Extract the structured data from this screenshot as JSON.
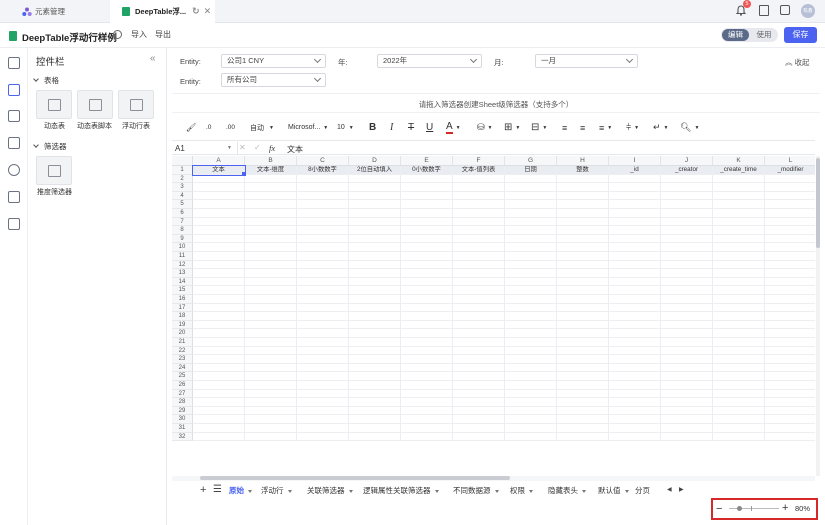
{
  "browser_tabs": [
    {
      "label": "元素管理",
      "active": false
    },
    {
      "label": "DeepTable浮...",
      "active": true
    }
  ],
  "notification_count": "5",
  "avatar_text": "陈鑫",
  "app": {
    "title": "DeepTable浮动行样例",
    "import_label": "导入",
    "export_label": "导出",
    "mode_edit": "编辑",
    "mode_use": "使用",
    "save_label": "保存"
  },
  "panel": {
    "title": "控件栏",
    "collapse": "«",
    "section_table": "表格",
    "section_filter": "筛选器",
    "components": [
      {
        "label": "动态表"
      },
      {
        "label": "动态表脚本"
      },
      {
        "label": "浮动行表"
      }
    ],
    "filters": [
      {
        "label": "推度筛选器"
      }
    ]
  },
  "filters": {
    "entity_label": "Entity:",
    "entity_value": "公司1 CNY",
    "year_label": "年:",
    "year_value": "2022年",
    "month_label": "月:",
    "month_value": "一月",
    "collapse_label": "收起",
    "entity2_label": "Entity:",
    "entity2_value": "所有公司",
    "drop_hint": "请拖入筛选器创建Sheet级筛选器（支持多个）"
  },
  "toolbar": {
    "auto_label": "自动",
    "font_label": "Microsof...",
    "size_label": "10"
  },
  "formula": {
    "cell_ref": "A1",
    "fx": "fx",
    "value": "文本"
  },
  "grid": {
    "columns": [
      "A",
      "B",
      "C",
      "D",
      "E",
      "F",
      "G",
      "H",
      "I",
      "J",
      "K",
      "L"
    ],
    "header_row": [
      "文本",
      "文本-维度",
      "8小数数字",
      "2位自动填入",
      "0小数数字",
      "文本-值列表",
      "日期",
      "整数",
      "_id",
      "_creator",
      "_create_time",
      "_modifier"
    ],
    "row_numbers": [
      "1",
      "2",
      "3",
      "4",
      "5",
      "6",
      "7",
      "8",
      "9",
      "10",
      "11",
      "12",
      "13",
      "14",
      "15",
      "16",
      "17",
      "18",
      "19",
      "20",
      "21",
      "22",
      "23",
      "24",
      "25",
      "26",
      "27",
      "28",
      "29",
      "30",
      "31",
      "32"
    ]
  },
  "sheet_tabs": [
    "原始",
    "浮动行",
    "关联筛选器",
    "逻辑属性关联筛选器",
    "不同数据源",
    "权限",
    "隐藏表头",
    "默认值",
    "分页"
  ],
  "active_sheet": "原始",
  "zoom": {
    "level": "80%",
    "value_percent": 80
  },
  "colors": {
    "accent": "#4b63f0",
    "active_tab_text": "#4b63f0",
    "highlight_border": "#d62828",
    "notif_badge": "#f05454"
  }
}
